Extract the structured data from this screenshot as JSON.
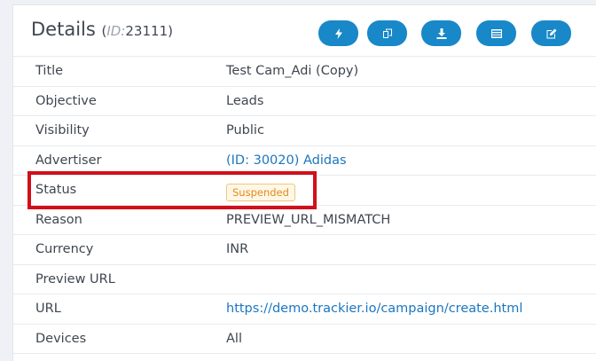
{
  "header": {
    "title": "Details",
    "id_label": "ID:",
    "id_value": "23111"
  },
  "actions": [
    {
      "name": "lightning-button",
      "icon": "lightning-icon"
    },
    {
      "name": "copy-button",
      "icon": "copy-icon"
    },
    {
      "name": "download-button",
      "icon": "download-icon"
    },
    {
      "name": "list-button",
      "icon": "list-icon"
    },
    {
      "name": "edit-button",
      "icon": "edit-icon"
    }
  ],
  "details": {
    "title": {
      "label": "Title",
      "value": "Test Cam_Adi (Copy)"
    },
    "objective": {
      "label": "Objective",
      "value": "Leads"
    },
    "visibility": {
      "label": "Visibility",
      "value": "Public"
    },
    "advertiser": {
      "label": "Advertiser",
      "value": "(ID: 30020) Adidas"
    },
    "status": {
      "label": "Status",
      "value": "Suspended"
    },
    "reason": {
      "label": "Reason",
      "value": "PREVIEW_URL_MISMATCH"
    },
    "currency": {
      "label": "Currency",
      "value": "INR"
    },
    "preview_url": {
      "label": "Preview URL",
      "value": ""
    },
    "url": {
      "label": "URL",
      "value": "https://demo.trackier.io/campaign/create.html"
    },
    "devices": {
      "label": "Devices",
      "value": "All"
    }
  },
  "colors": {
    "accent": "#1888c8",
    "link": "#1b76c0",
    "badge_warning": "#e08b1a",
    "highlight": "#d10f1b"
  }
}
